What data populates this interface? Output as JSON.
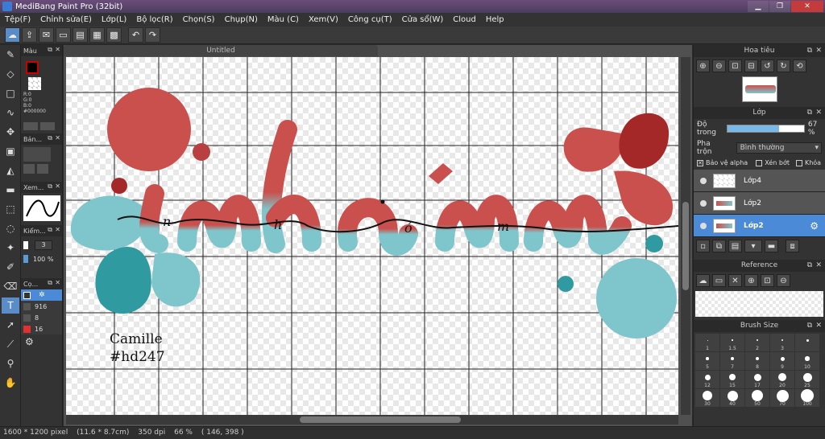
{
  "window": {
    "title": "MediBang Paint Pro (32bit)"
  },
  "menu": [
    "Tệp(F)",
    "Chỉnh sửa(E)",
    "Lớp(L)",
    "Bộ lọc(R)",
    "Chọn(S)",
    "Chụp(N)",
    "Màu (C)",
    "Xem(V)",
    "Công cụ(T)",
    "Cửa sổ(W)",
    "Cloud",
    "Help"
  ],
  "toolbar_icons": [
    "cloud-icon",
    "export-icon",
    "chat-icon",
    "note-icon",
    "page-icon",
    "grid-icon",
    "tiles-icon",
    "undo-icon",
    "redo-icon"
  ],
  "tools": [
    "brush-icon",
    "eraser-icon",
    "rectangle-icon",
    "dotpen-icon",
    "move-icon",
    "select-rect-icon",
    "bucket-icon",
    "gradient-icon",
    "lasso-icon",
    "select-ellipse-icon",
    "magic-wand-icon",
    "select-pen-icon",
    "select-eraser-icon",
    "text-icon",
    "operation-icon",
    "eyedropper-icon",
    "hand-icon"
  ],
  "left_panels": {
    "color": {
      "title": "Màu",
      "fg": "#000000",
      "r": "R:0",
      "g": "G:0",
      "b": "B:0",
      "hex": "#000000"
    },
    "brush": {
      "title": "Bản..."
    },
    "curve": {
      "title": "Xem..."
    },
    "size": {
      "title": "Kiểm...",
      "value": "3",
      "opacity": "100 %"
    },
    "layers_mini": {
      "title": "Cọ...",
      "values": [
        "916",
        "8",
        "16"
      ]
    }
  },
  "document": {
    "tab": "Untitled"
  },
  "canvas_text": {
    "line1": "Camille",
    "line2": "#hd247"
  },
  "colors": {
    "red": "#c9504c",
    "darkred": "#a52828",
    "teal": "#7ec6cc",
    "darkteal": "#2f9aa0"
  },
  "navigator": {
    "title": "Hoa tiêu"
  },
  "layer_panel": {
    "title": "Lớp",
    "opacity_label": "Độ trong",
    "opacity_value": "67 %",
    "opacity_fraction": 0.67,
    "blend_label": "Pha trộn",
    "blend_value": "Bình thường",
    "protect_alpha": "Bảo vệ alpha",
    "clipping": "Xén bớt",
    "lock": "Khóa",
    "layers": [
      {
        "name": "Lớp4",
        "selected": false
      },
      {
        "name": "Lớp2",
        "selected": false
      },
      {
        "name": "Lớp2",
        "selected": true
      }
    ]
  },
  "reference": {
    "title": "Reference"
  },
  "brush_size": {
    "title": "Brush Size",
    "sizes": [
      "1",
      "1.5",
      "2",
      "3",
      "",
      "5",
      "7",
      "8",
      "9",
      "10",
      "12",
      "15",
      "17",
      "20",
      "25",
      "30",
      "40",
      "50",
      "70",
      "100"
    ]
  },
  "status": {
    "pixels": "1600 * 1200 pixel",
    "cm": "(11.6 * 8.7cm)",
    "dpi": "350 dpi",
    "zoom": "66 %",
    "coords": "( 146, 398 )"
  }
}
